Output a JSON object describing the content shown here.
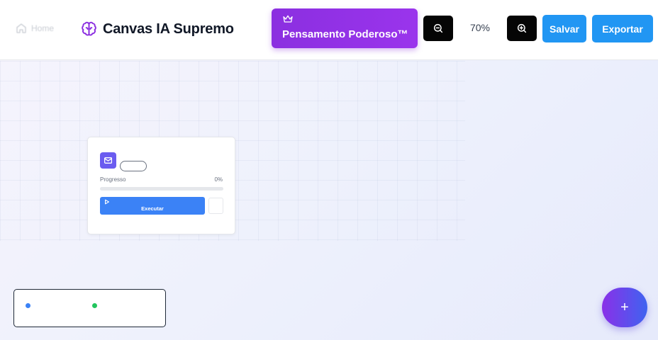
{
  "header": {
    "home_label": "Home",
    "brand_title": "Canvas IA Supremo",
    "power_button_label": "Pensamento Poderoso™",
    "zoom_level": "70%",
    "save_label": "Salvar",
    "export_label": "Exportar"
  },
  "node": {
    "title": "",
    "progress_label": "Progresso",
    "progress_value": "0%",
    "progress_fraction": 0,
    "execute_label": "Executar"
  },
  "legend": {
    "items": [
      {
        "label": "",
        "color": "#3b82f6"
      },
      {
        "label": "",
        "color": "#22c55e"
      }
    ]
  },
  "fab": {
    "label": "+"
  },
  "colors": {
    "accent_purple": "#9333ea",
    "accent_blue": "#2196f3",
    "node_icon": "#6b5cf0",
    "execute_blue": "#3b82f6"
  }
}
